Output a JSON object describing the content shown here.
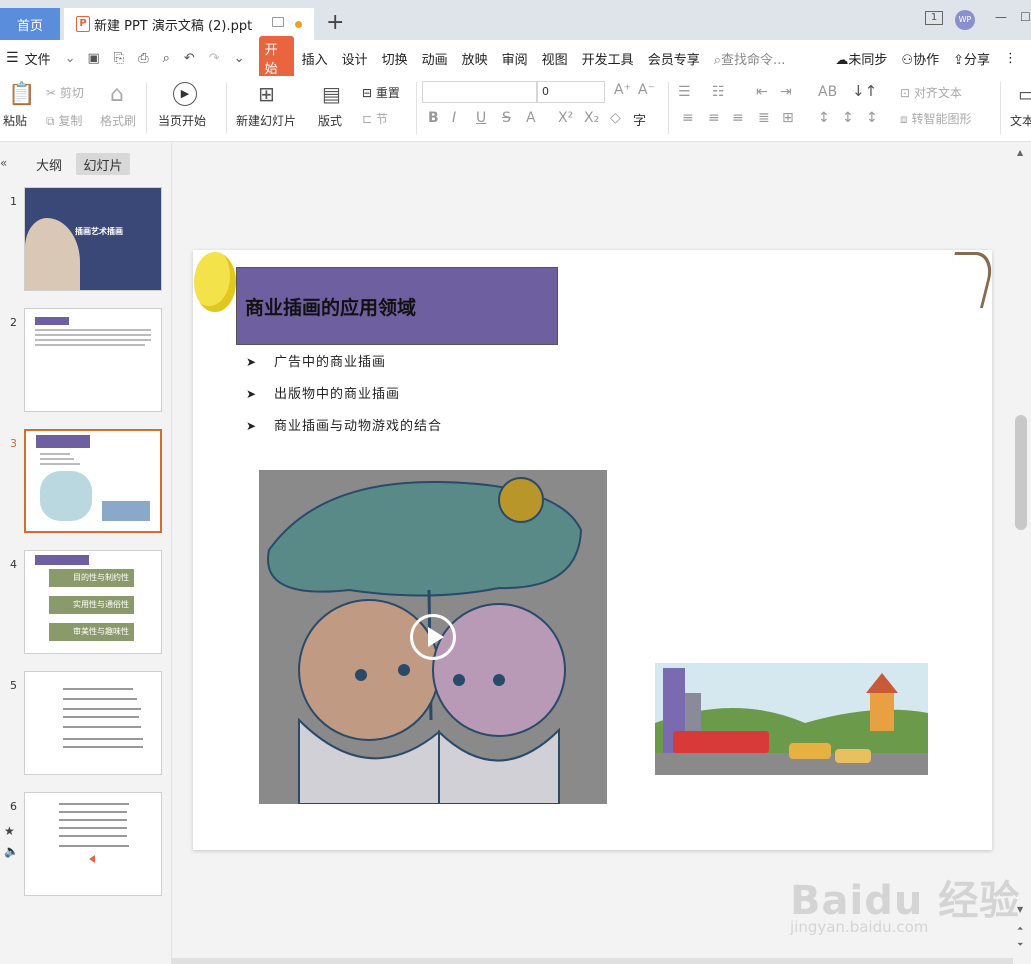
{
  "tabs": {
    "home": "首页",
    "document": "新建 PPT 演示文稿 (2).ppt",
    "new_tab": "+"
  },
  "window": {
    "layout_icon": "1",
    "avatar": "WP",
    "minimize": "—",
    "maximize": "☐"
  },
  "menu": {
    "file": "文件",
    "items": [
      "开始",
      "插入",
      "设计",
      "切换",
      "动画",
      "放映",
      "审阅",
      "视图",
      "开发工具",
      "会员专享"
    ],
    "search_placeholder": "查找命令...",
    "sync": "未同步",
    "collab": "协作",
    "share": "分享"
  },
  "ribbon": {
    "paste": "粘贴",
    "cut": "剪切",
    "copy": "复制",
    "format_painter": "格式刷",
    "play_from_current": "当页开始",
    "new_slide": "新建幻灯片",
    "layout": "版式",
    "reset": "重置",
    "section": "节",
    "font_size": "0",
    "align_text": "对齐文本",
    "smartart": "转智能图形",
    "text_box": "文本"
  },
  "panel": {
    "outline_tab": "大纲",
    "slides_tab": "幻灯片",
    "collapse": "«"
  },
  "thumbnails": [
    {
      "num": "1",
      "title": "插画艺术插画"
    },
    {
      "num": "2",
      "title": ""
    },
    {
      "num": "3",
      "title": ""
    },
    {
      "num": "4",
      "items": [
        "目的性与制约性",
        "实用性与通俗性",
        "审美性与趣味性"
      ]
    },
    {
      "num": "5"
    },
    {
      "num": "6"
    }
  ],
  "slide": {
    "title": "商业插画的应用领域",
    "bullets": [
      "广告中的商业插画",
      "出版物中的商业插画",
      "商业插画与动物游戏的结合"
    ]
  },
  "watermark": {
    "line1": "Baidu 经验",
    "line2": "jingyan.baidu.com"
  },
  "colors": {
    "accent": "#e8653f",
    "title_box": "#6e60a0",
    "home_tab": "#5a8ddb"
  }
}
